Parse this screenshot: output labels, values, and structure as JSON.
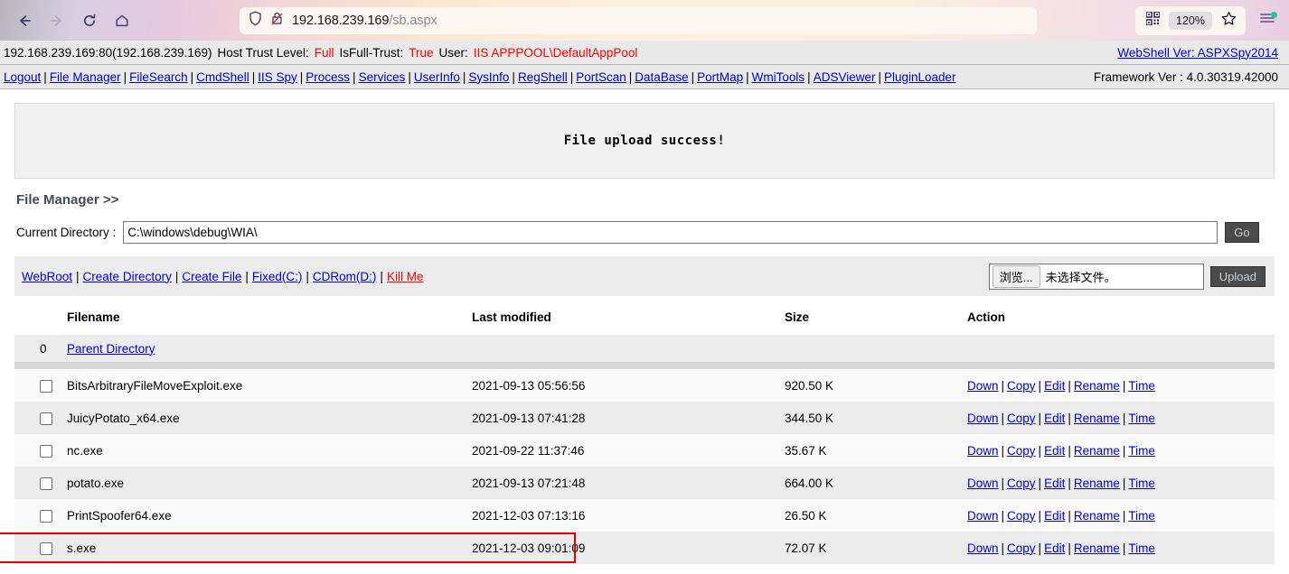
{
  "browser": {
    "back_icon": "back-arrow-icon",
    "forward_icon": "forward-arrow-icon",
    "reload_icon": "reload-icon",
    "home_icon": "home-icon",
    "shield_icon": "shield-icon",
    "lock_broken_icon": "lock-crossed-icon",
    "url_host": "192.168.239.169",
    "url_path": "/sb.aspx",
    "qr_icon": "qr-code-icon",
    "zoom_level": "120%",
    "bookmark_icon": "star-icon",
    "menu_icon": "hamburger-menu-icon"
  },
  "topinfo": {
    "host": "192.168.239.169:80(192.168.239.169)",
    "trust_label": "Host Trust Level:",
    "trust_value": "Full",
    "isfull_label": "IsFull-Trust:",
    "isfull_value": "True",
    "user_label": "User:",
    "user_value": "IIS APPPOOL\\DefaultAppPool",
    "webshell_ver": "WebShell Ver: ASPXSpy2014"
  },
  "navbar": {
    "items": [
      "Logout",
      "File Manager",
      "FileSearch",
      "CmdShell",
      "IIS Spy",
      "Process",
      "Services",
      "UserInfo",
      "SysInfo",
      "RegShell",
      "PortScan",
      "DataBase",
      "PortMap",
      "WmiTools",
      "ADSViewer",
      "PluginLoader"
    ],
    "framework_ver": "Framework Ver : 4.0.30319.42000"
  },
  "message": {
    "text": "File upload success!"
  },
  "filemanager": {
    "title": "File Manager >>",
    "dir_label": "Current Directory :",
    "dir_value": "C:\\windows\\debug\\WIA\\",
    "go_label": "Go",
    "quicklinks": [
      {
        "label": "WebRoot",
        "danger": false
      },
      {
        "label": "Create Directory",
        "danger": false
      },
      {
        "label": "Create File",
        "danger": false
      },
      {
        "label": "Fixed(C:)",
        "danger": false
      },
      {
        "label": "CDRom(D:)",
        "danger": false
      },
      {
        "label": "Kill Me",
        "danger": true
      }
    ],
    "upload": {
      "browse_label": "浏览...",
      "no_file_text": "未选择文件。",
      "upload_label": "Upload"
    }
  },
  "table": {
    "headers": [
      "",
      "Filename",
      "Last modified",
      "Size",
      "Action"
    ],
    "parent": {
      "index": "0",
      "label": "Parent Directory"
    },
    "action_links": [
      "Down",
      "Copy",
      "Edit",
      "Rename",
      "Time"
    ],
    "rows": [
      {
        "name": "BitsArbitraryFileMoveExploit.exe",
        "modified": "2021-09-13 05:56:56",
        "size": "920.50 K",
        "highlight": false
      },
      {
        "name": "JuicyPotato_x64.exe",
        "modified": "2021-09-13 07:41:28",
        "size": "344.50 K",
        "highlight": false
      },
      {
        "name": "nc.exe",
        "modified": "2021-09-22 11:37:46",
        "size": "35.67 K",
        "highlight": false
      },
      {
        "name": "potato.exe",
        "modified": "2021-09-13 07:21:48",
        "size": "664.00 K",
        "highlight": false
      },
      {
        "name": "PrintSpoofer64.exe",
        "modified": "2021-12-03 07:13:16",
        "size": "26.50 K",
        "highlight": false
      },
      {
        "name": "s.exe",
        "modified": "2021-12-03 09:01:09",
        "size": "72.07 K",
        "highlight": true
      }
    ]
  },
  "colors": {
    "link": "#0000cc",
    "danger": "#ff0000",
    "highlight_box": "#e00000",
    "chrome_accent": "#2ac3a2"
  }
}
